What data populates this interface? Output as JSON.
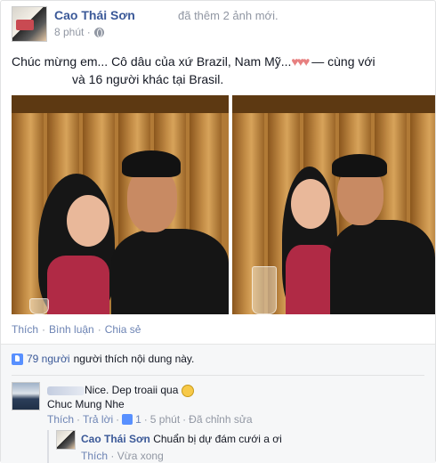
{
  "post": {
    "author": "Cao Thái Sơn",
    "action": "đã thêm 2 ảnh mới.",
    "time": "8 phút ·",
    "caption_line1_prefix": "Chúc mừng em... Cô dâu của xứ Brazil, Nam Mỹ...",
    "caption_hearts": "♥♥♥",
    "caption_line1_suffix": " — cùng với",
    "caption_line2": "và 16 người khác tại Brasil.",
    "icons": {
      "privacy": "globe-icon"
    }
  },
  "actions": {
    "like": "Thích",
    "dot1": "·",
    "comment": "Bình luận",
    "dot2": "·",
    "share": "Chia sẻ"
  },
  "likes": {
    "count_text": "79 người",
    "rest_text": "người thích nội dung này."
  },
  "comments": [
    {
      "text_suffix": "Nice. Dep troaii qua",
      "line2": "Chuc Mung Nhe",
      "like": "Thích",
      "reply": "Trả lời",
      "like_count": "1",
      "time": "5 phút",
      "edited": "Đã chỉnh sửa"
    },
    {
      "author": "Cao Thái Sơn",
      "text": "Chuẩn bị dự đám cưới a ơi",
      "like": "Thích",
      "time": "Vừa xong"
    }
  ],
  "colors": {
    "link": "#3b5998",
    "meta": "#9197a3",
    "accent": "#5890ff"
  }
}
